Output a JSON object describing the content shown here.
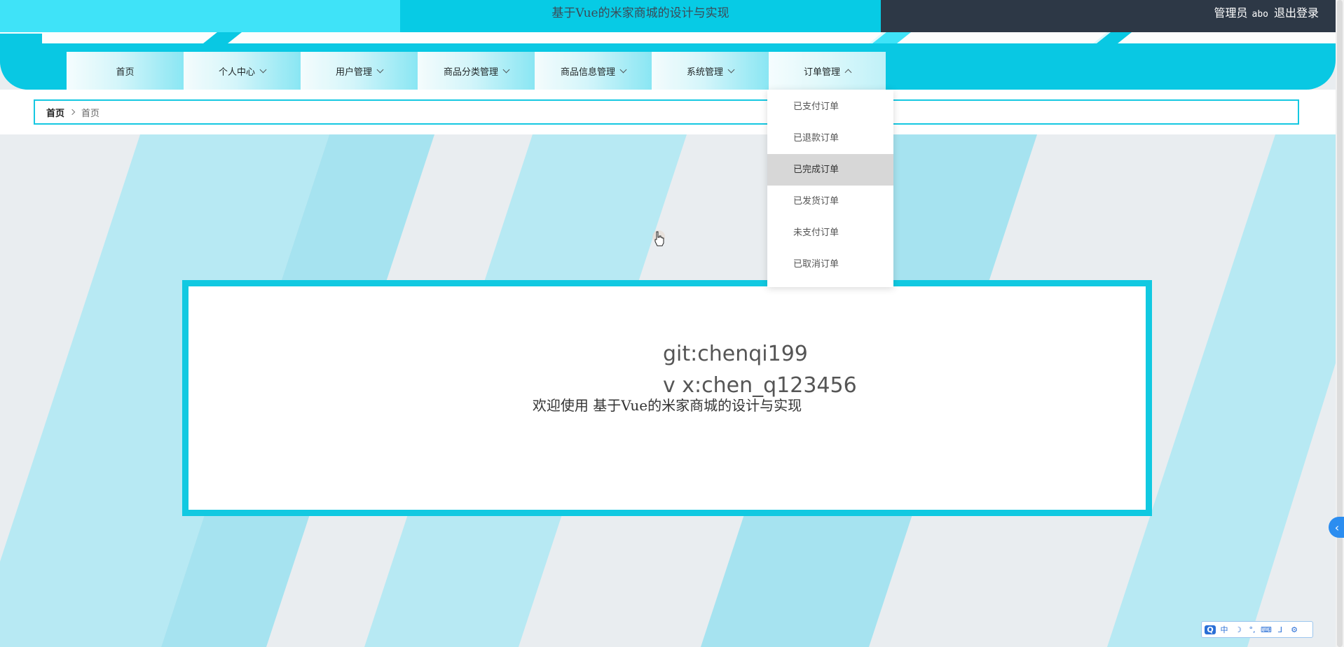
{
  "header": {
    "site_title": "基于Vue的米家商城的设计与实现",
    "role_label": "管理员",
    "username": "abo",
    "logout_label": "退出登录"
  },
  "nav": {
    "items": [
      {
        "label": "首页",
        "has_caret": false
      },
      {
        "label": "个人中心",
        "has_caret": true
      },
      {
        "label": "用户管理",
        "has_caret": true
      },
      {
        "label": "商品分类管理",
        "has_caret": true
      },
      {
        "label": "商品信息管理",
        "has_caret": true
      },
      {
        "label": "系统管理",
        "has_caret": true
      },
      {
        "label": "订单管理",
        "has_caret": true,
        "open": true
      }
    ]
  },
  "breadcrumb": {
    "home": "首页",
    "current": "首页"
  },
  "order_menu": {
    "items": [
      "已支付订单",
      "已退款订单",
      "已完成订单",
      "已发货订单",
      "未支付订单",
      "已取消订单"
    ],
    "hovered_index": 2
  },
  "welcome": {
    "watermark_line1": "git:chenqi199",
    "watermark_line2": "v x:chen_q123456",
    "text": "欢迎使用 基于Vue的米家商城的设计与实现"
  },
  "colors": {
    "accent": "#09c8e3",
    "header_dark": "#2d3846",
    "header_light": "#3fe3f8"
  },
  "ime": {
    "chars": [
      "中",
      "☽",
      "°,",
      "⌨",
      "⅃",
      "⚙",
      "🔧"
    ]
  }
}
